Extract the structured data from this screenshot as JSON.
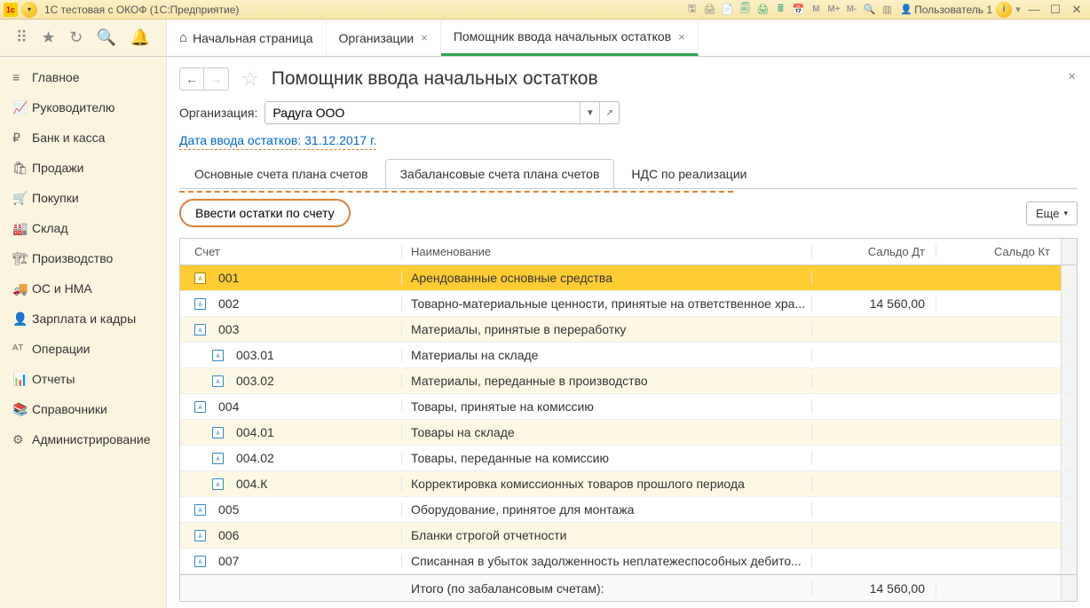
{
  "window": {
    "title": "1С тестовая с ОКОФ  (1С:Предприятие)",
    "user": "Пользователь 1"
  },
  "tabs": {
    "home": "Начальная страница",
    "org": "Организации",
    "assist": "Помощник ввода начальных остатков"
  },
  "sidebar": {
    "items": [
      {
        "icon": "≡",
        "label": "Главное"
      },
      {
        "icon": "📈",
        "label": "Руководителю"
      },
      {
        "icon": "₽",
        "label": "Банк и касса"
      },
      {
        "icon": "🛍",
        "label": "Продажи"
      },
      {
        "icon": "🛒",
        "label": "Покупки"
      },
      {
        "icon": "🏭",
        "label": "Склад"
      },
      {
        "icon": "🏗",
        "label": "Производство"
      },
      {
        "icon": "🚚",
        "label": "ОС и НМА"
      },
      {
        "icon": "👤",
        "label": "Зарплата и кадры"
      },
      {
        "icon": "ᴬᵀ",
        "label": "Операции"
      },
      {
        "icon": "📊",
        "label": "Отчеты"
      },
      {
        "icon": "📚",
        "label": "Справочники"
      },
      {
        "icon": "⚙",
        "label": "Администрирование"
      }
    ]
  },
  "page": {
    "title": "Помощник ввода начальных остатков",
    "org_label": "Организация:",
    "org_value": "Радуга ООО",
    "date_link": "Дата ввода остатков: 31.12.2017 г."
  },
  "subtabs": {
    "t1": "Основные счета плана счетов",
    "t2": "Забалансовые счета плана счетов",
    "t3": "НДС по реализации"
  },
  "actions": {
    "enter": "Ввести остатки по счету",
    "more": "Еще"
  },
  "table": {
    "headers": {
      "acc": "Счет",
      "name": "Наименование",
      "dt": "Сальдо Дт",
      "kt": "Сальдо Кт"
    },
    "rows": [
      {
        "acc": "001",
        "name": "Арендованные основные средства",
        "dt": "",
        "kt": "",
        "sel": true,
        "indent": 0
      },
      {
        "acc": "002",
        "name": "Товарно-материальные ценности, принятые на ответственное хра...",
        "dt": "14 560,00",
        "kt": "",
        "indent": 0
      },
      {
        "acc": "003",
        "name": "Материалы, принятые в переработку",
        "dt": "",
        "kt": "",
        "indent": 0
      },
      {
        "acc": "003.01",
        "name": "Материалы на складе",
        "dt": "",
        "kt": "",
        "indent": 1
      },
      {
        "acc": "003.02",
        "name": "Материалы, переданные в производство",
        "dt": "",
        "kt": "",
        "indent": 1
      },
      {
        "acc": "004",
        "name": "Товары, принятые на комиссию",
        "dt": "",
        "kt": "",
        "indent": 0
      },
      {
        "acc": "004.01",
        "name": "Товары на складе",
        "dt": "",
        "kt": "",
        "indent": 1
      },
      {
        "acc": "004.02",
        "name": "Товары, переданные на комиссию",
        "dt": "",
        "kt": "",
        "indent": 1
      },
      {
        "acc": "004.К",
        "name": "Корректировка комиссионных товаров прошлого периода",
        "dt": "",
        "kt": "",
        "indent": 1
      },
      {
        "acc": "005",
        "name": "Оборудование, принятое для монтажа",
        "dt": "",
        "kt": "",
        "indent": 0
      },
      {
        "acc": "006",
        "name": "Бланки строгой отчетности",
        "dt": "",
        "kt": "",
        "indent": 0
      },
      {
        "acc": "007",
        "name": "Списанная в убыток задолженность неплатежеспособных дебито...",
        "dt": "",
        "kt": "",
        "indent": 0
      }
    ],
    "footer": {
      "label": "Итого (по забалансовым счетам):",
      "dt": "14 560,00",
      "kt": ""
    }
  }
}
